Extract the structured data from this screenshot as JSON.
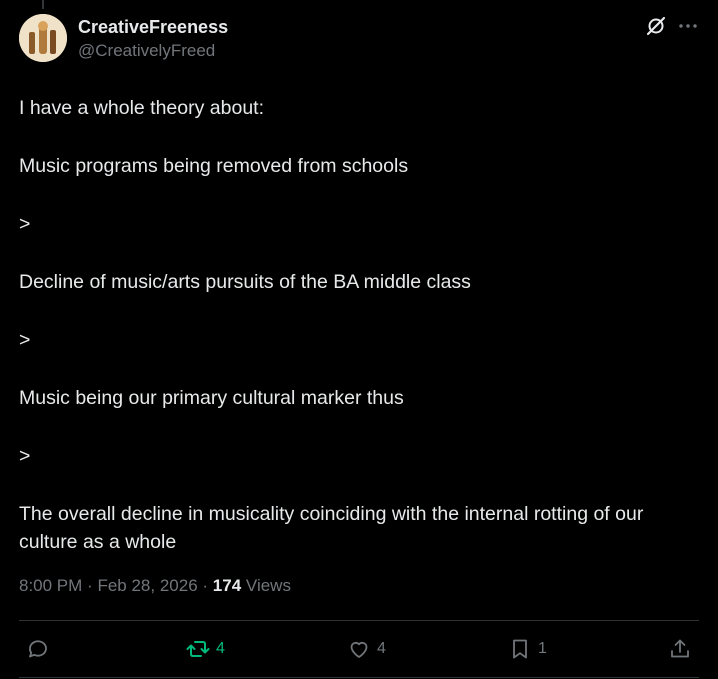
{
  "post": {
    "author": {
      "display_name": "CreativeFreeness",
      "handle": "@CreativelyFreed"
    },
    "paragraphs": [
      "I have a whole theory about:",
      "Music programs being removed from schools",
      ">",
      "Decline of music/arts pursuits of the BA middle class",
      ">",
      "Music being our primary cultural marker thus",
      ">",
      "The overall decline in musicality coinciding with the internal rotting of our culture as a whole"
    ],
    "time": "8:00 PM",
    "separator": "·",
    "date": "Feb 28, 2026",
    "views_count": "174",
    "views_label": "Views"
  },
  "actions": {
    "reply": {
      "icon": "reply-icon",
      "count": ""
    },
    "repost": {
      "icon": "repost-icon",
      "count": "4",
      "active_color": "#00ba7c"
    },
    "like": {
      "icon": "heart-icon",
      "count": "4"
    },
    "bookmark": {
      "icon": "bookmark-icon",
      "count": "1"
    },
    "share": {
      "icon": "share-icon",
      "count": ""
    }
  },
  "colors": {
    "background": "#000000",
    "text": "#e7e9ea",
    "secondary_text": "#71767b",
    "divider": "#2f3336",
    "repost_green": "#00ba7c"
  }
}
